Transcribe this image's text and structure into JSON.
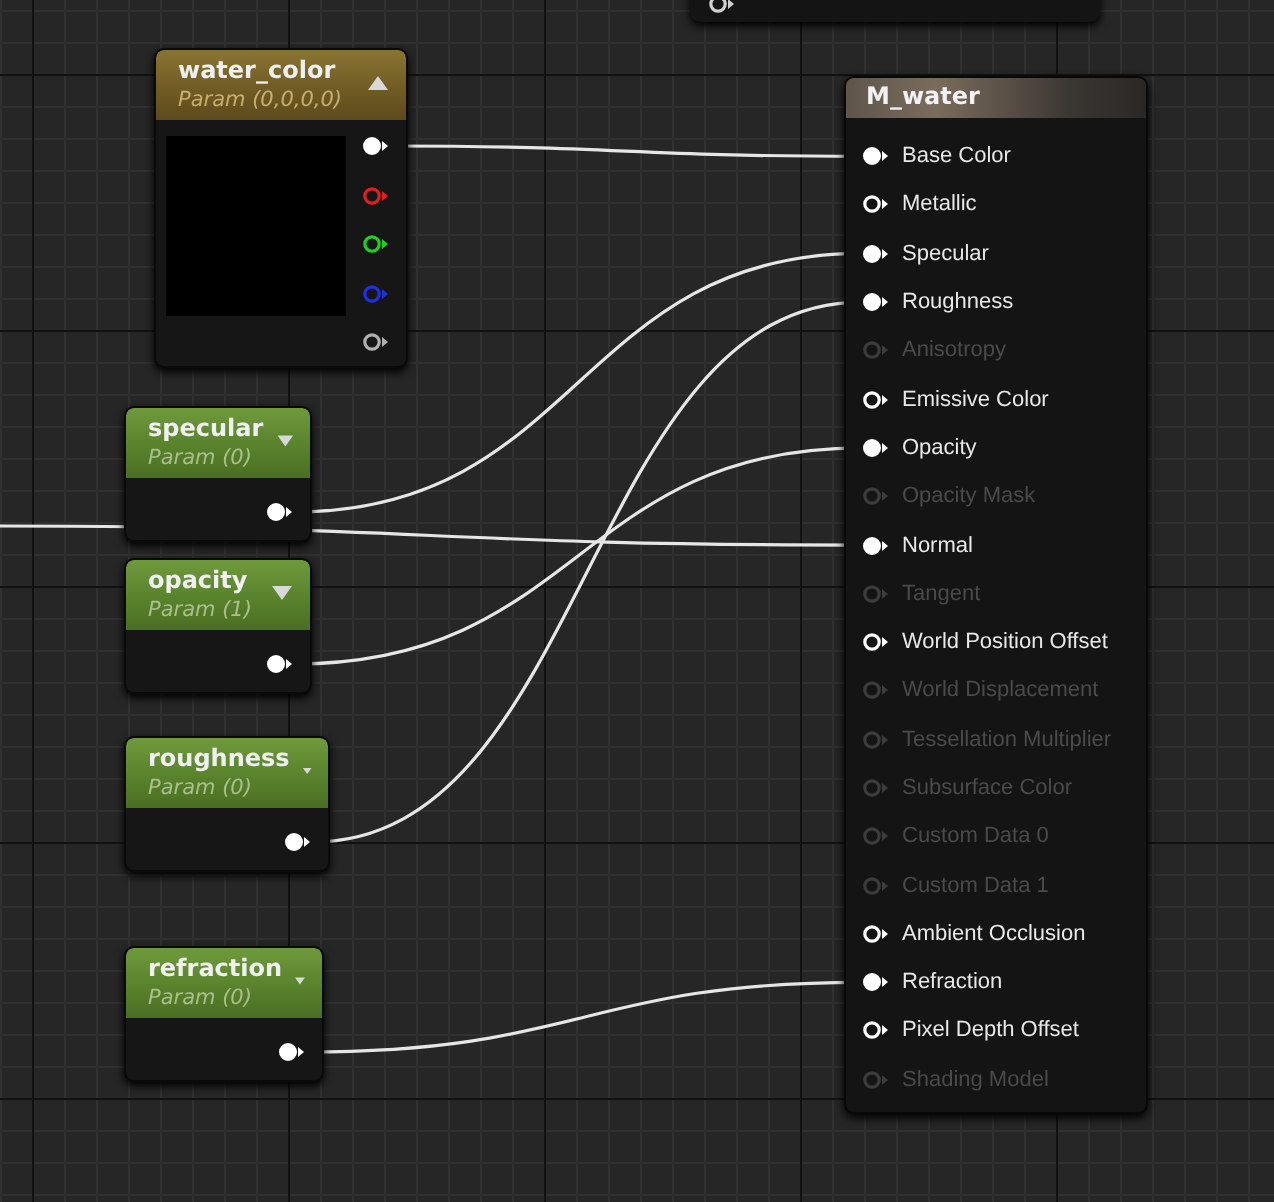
{
  "graph": {
    "fragment_node": {
      "pins": [
        {
          "connected": false
        }
      ]
    },
    "param_nodes": [
      {
        "kind": "vector",
        "title": "water_color",
        "subtitle": "Param (0,0,0,0)",
        "expanded": true,
        "pins": [
          {
            "color": "#ffffff",
            "connected": true
          },
          {
            "color": "#e02020",
            "connected": false
          },
          {
            "color": "#20d020",
            "connected": false
          },
          {
            "color": "#2030e0",
            "connected": false
          },
          {
            "color": "#b0b0b0",
            "connected": false
          }
        ]
      },
      {
        "kind": "scalar",
        "title": "specular",
        "subtitle": "Param (0)",
        "expanded": false,
        "pins": [
          {
            "color": "#ffffff",
            "connected": true
          }
        ]
      },
      {
        "kind": "scalar",
        "title": "opacity",
        "subtitle": "Param (1)",
        "expanded": false,
        "pins": [
          {
            "color": "#ffffff",
            "connected": true
          }
        ]
      },
      {
        "kind": "scalar",
        "title": "roughness",
        "subtitle": "Param (0)",
        "expanded": false,
        "pins": [
          {
            "color": "#ffffff",
            "connected": true
          }
        ]
      },
      {
        "kind": "scalar",
        "title": "refraction",
        "subtitle": "Param (0)",
        "expanded": false,
        "pins": [
          {
            "color": "#ffffff",
            "connected": true
          }
        ]
      }
    ],
    "result_node": {
      "title": "M_water",
      "pins": [
        {
          "label": "Base Color",
          "connected": true,
          "disabled": false
        },
        {
          "label": "Metallic",
          "connected": false,
          "disabled": false
        },
        {
          "label": "Specular",
          "connected": true,
          "disabled": false
        },
        {
          "label": "Roughness",
          "connected": true,
          "disabled": false
        },
        {
          "label": "Anisotropy",
          "connected": false,
          "disabled": true
        },
        {
          "label": "Emissive Color",
          "connected": false,
          "disabled": false
        },
        {
          "label": "Opacity",
          "connected": true,
          "disabled": false
        },
        {
          "label": "Opacity Mask",
          "connected": false,
          "disabled": true
        },
        {
          "label": "Normal",
          "connected": true,
          "disabled": false
        },
        {
          "label": "Tangent",
          "connected": false,
          "disabled": true
        },
        {
          "label": "World Position Offset",
          "connected": false,
          "disabled": false
        },
        {
          "label": "World Displacement",
          "connected": false,
          "disabled": true
        },
        {
          "label": "Tessellation Multiplier",
          "connected": false,
          "disabled": true
        },
        {
          "label": "Subsurface Color",
          "connected": false,
          "disabled": true
        },
        {
          "label": "Custom Data 0",
          "connected": false,
          "disabled": true
        },
        {
          "label": "Custom Data 1",
          "connected": false,
          "disabled": true
        },
        {
          "label": "Ambient Occlusion",
          "connected": false,
          "disabled": false
        },
        {
          "label": "Refraction",
          "connected": true,
          "disabled": false
        },
        {
          "label": "Pixel Depth Offset",
          "connected": false,
          "disabled": false
        },
        {
          "label": "Shading Model",
          "connected": false,
          "disabled": true
        }
      ]
    }
  }
}
